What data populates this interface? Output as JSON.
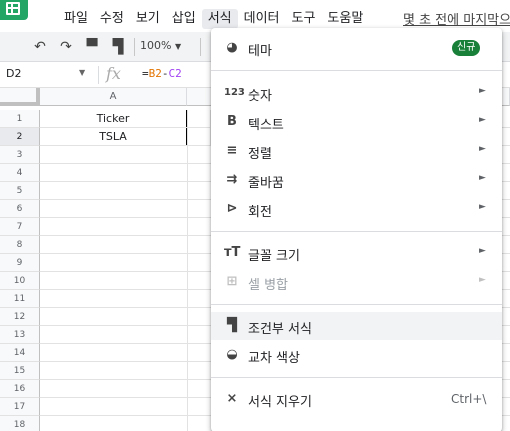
{
  "menubar": {
    "items": [
      "파일",
      "수정",
      "보기",
      "삽입",
      "서식",
      "데이터",
      "도구",
      "도움말"
    ],
    "active_index": 4,
    "last_edit": "몇 초 전에 마지막으"
  },
  "toolbar": {
    "zoom": "100%"
  },
  "formula_bar": {
    "name_box": "D2",
    "fx": "fx",
    "formula_prefix": "=",
    "ref1": "B2",
    "op": "-",
    "ref2": "C2"
  },
  "grid": {
    "column_header": "A",
    "row_numbers": [
      "1",
      "2",
      "3",
      "4",
      "5",
      "6",
      "7",
      "8",
      "9",
      "10",
      "11",
      "12",
      "13",
      "14",
      "15",
      "16",
      "17",
      "18"
    ],
    "cells": {
      "A1": "Ticker",
      "A2": "TSLA"
    }
  },
  "format_menu": {
    "theme_label": "테마",
    "theme_badge": "신규",
    "number_label": "숫자",
    "text_label": "텍스트",
    "align_label": "정렬",
    "wrap_label": "줄바꿈",
    "rotate_label": "회전",
    "font_size_label": "글꼴 크기",
    "merge_label": "셀 병합",
    "conditional_label": "조건부 서식",
    "alternating_label": "교차 색상",
    "clear_label": "서식 지우기",
    "clear_shortcut": "Ctrl+\\"
  }
}
